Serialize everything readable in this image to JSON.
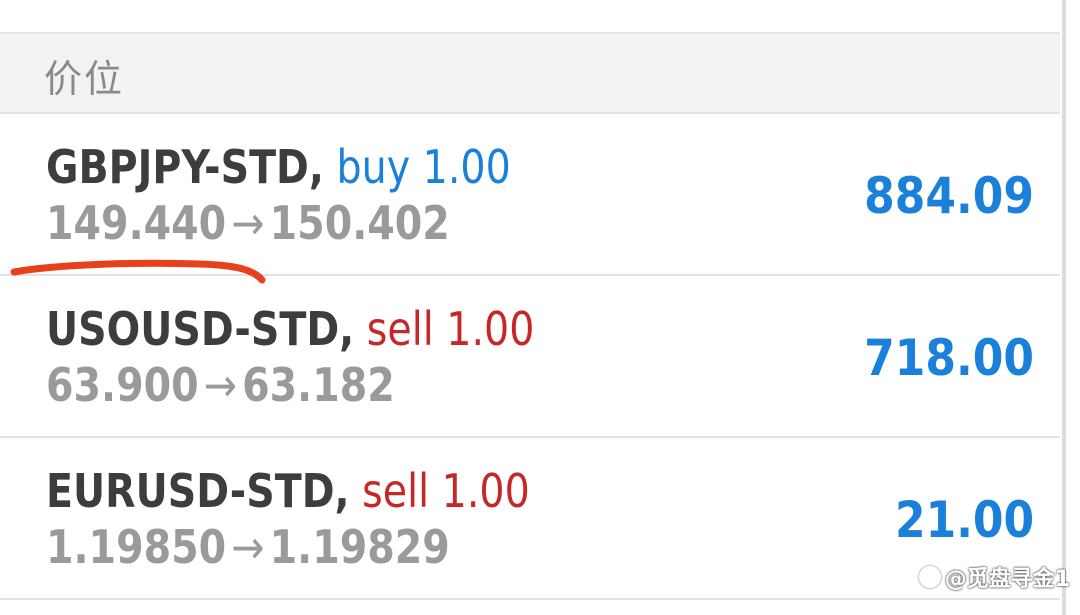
{
  "section": {
    "title": "价位"
  },
  "positions": [
    {
      "symbol": "GBPJPY-STD,",
      "side": "buy",
      "volume": "1.00",
      "open_price": "149.440",
      "arrow": "→",
      "current_price": "150.402",
      "profit": "884.09"
    },
    {
      "symbol": "USOUSD-STD,",
      "side": "sell",
      "volume": "1.00",
      "open_price": "63.900",
      "arrow": "→",
      "current_price": "63.182",
      "profit": "718.00"
    },
    {
      "symbol": "EURUSD-STD,",
      "side": "sell",
      "volume": "1.00",
      "open_price": "1.19850",
      "arrow": "→",
      "current_price": "1.19829",
      "profit": "21.00"
    }
  ],
  "colors": {
    "buy": "#1a80d9",
    "sell": "#c62828",
    "profit": "#1a80d9",
    "annotation": "#e8401c"
  },
  "watermark": {
    "text": "@觅盘寻金1"
  }
}
